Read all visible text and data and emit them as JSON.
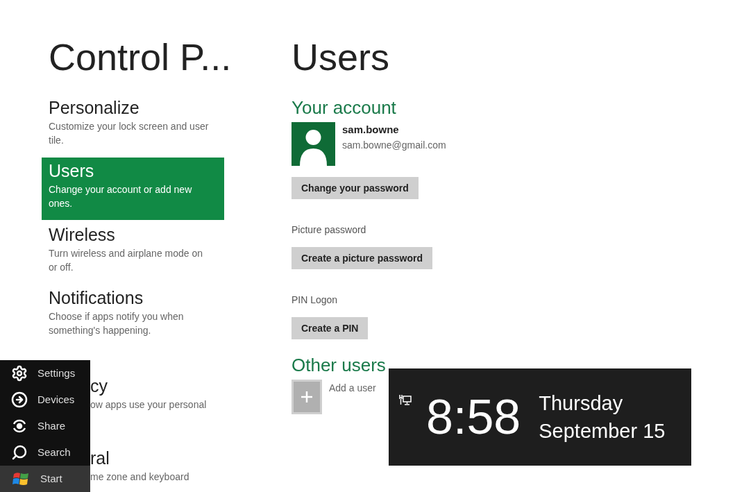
{
  "nav": {
    "title": "Control P...",
    "items": [
      {
        "kind": "full",
        "label": "Personalize",
        "description": "Customize your lock screen and user tile.",
        "selected": false
      },
      {
        "kind": "full",
        "label": "Users",
        "description": "Change your account or add new ones.",
        "selected": true
      },
      {
        "kind": "full",
        "label": "Wireless",
        "description": "Turn wireless and airplane mode on or off.",
        "selected": false
      },
      {
        "kind": "full",
        "label": "Notifications",
        "description": "Choose if apps notify you when something's happening.",
        "selected": false
      },
      {
        "kind": "clipped",
        "label": "cy",
        "description": "ow apps use your personal",
        "selected": false
      },
      {
        "kind": "clipped",
        "label": "ral",
        "description": "me zone and keyboard",
        "selected": false
      }
    ]
  },
  "content": {
    "title": "Users",
    "account_heading": "Your account",
    "user_name": "sam.bowne",
    "user_email": "sam.bowne@gmail.com",
    "change_password_button": "Change your password",
    "picture_password_label": "Picture password",
    "picture_password_button": "Create a picture password",
    "pin_label": "PIN Logon",
    "pin_button": "Create a PIN",
    "other_users_heading": "Other users",
    "add_user_label": "Add a user"
  },
  "charms": [
    {
      "kind": "settings",
      "label": "Settings",
      "selected": false
    },
    {
      "kind": "devices",
      "label": "Devices",
      "selected": false
    },
    {
      "kind": "share",
      "label": "Share",
      "selected": false
    },
    {
      "kind": "search",
      "label": "Search",
      "selected": false
    },
    {
      "kind": "start",
      "label": "Start",
      "selected": true
    }
  ],
  "clock": {
    "time": "8:58",
    "day": "Thursday",
    "date": "September 15"
  }
}
